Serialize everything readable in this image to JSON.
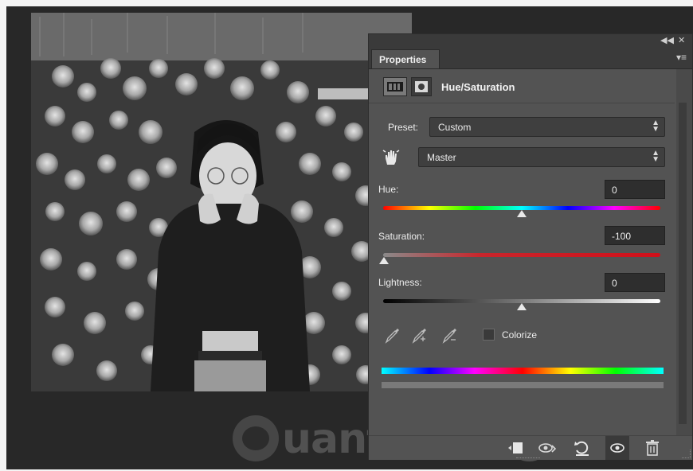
{
  "canvas": {
    "description_icon": "photo-canvas"
  },
  "watermark": {
    "text": "uantrimang"
  },
  "panel": {
    "title_tab": "Properties",
    "collapse_icon": "double-chevron-left-icon",
    "close_icon": "close-icon",
    "menu_icon": "panel-menu-icon",
    "adjustment_title": "Hue/Saturation",
    "preset_label": "Preset:",
    "preset_value": "Custom",
    "channel_value": "Master",
    "hue_label": "Hue:",
    "hue_value": "0",
    "saturation_label": "Saturation:",
    "saturation_value": "-100",
    "lightness_label": "Lightness:",
    "lightness_value": "0",
    "colorize_label": "Colorize",
    "colorize_checked": false,
    "sliders": {
      "hue_fraction": 0.5,
      "saturation_fraction": 0.0,
      "lightness_fraction": 0.5
    }
  },
  "colors": {
    "panel_bg": "#535353",
    "app_bg": "#282828",
    "saturation_red": "#c8262c"
  }
}
